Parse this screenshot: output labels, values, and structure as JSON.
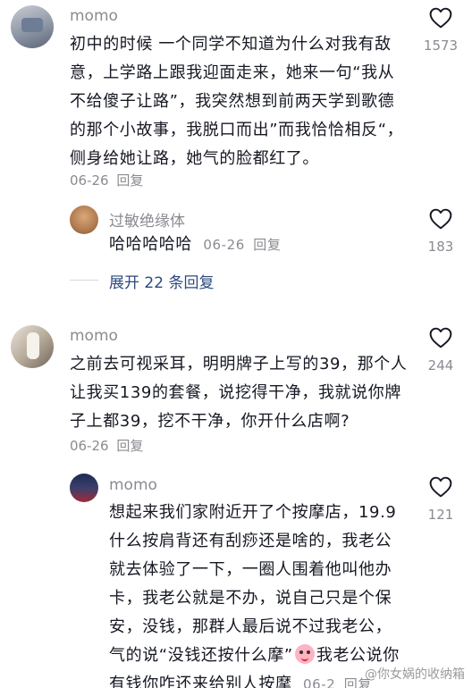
{
  "comments": [
    {
      "username": "momo",
      "text": "初中的时候 一个同学不知道为什么对我有敌意，上学路上跟我迎面走来，她来一句“我从不给傻子让路”，我突然想到前两天学到歌德的那个小故事，我脱口而出”而我恰恰相反“，侧身给她让路，她气的脸都红了。",
      "date": "06-26",
      "reply_label": "回复",
      "likes": "1573",
      "replies": [
        {
          "username": "过敏绝缘体",
          "text": "哈哈哈哈哈",
          "date": "06-26",
          "reply_label": "回复",
          "likes": "183"
        }
      ],
      "expand_label": "展开 22 条回复"
    },
    {
      "username": "momo",
      "text": "之前去可视采耳，明明牌子上写的39，那个人让我买139的套餐，说挖得干净，我就说你牌子上都39，挖不干净，你开什么店啊?",
      "date": "06-26",
      "reply_label": "回复",
      "likes": "244",
      "replies": [
        {
          "username": "momo",
          "text_before_emoji": "想起来我们家附近开了个按摩店，19.9什么按肩背还有刮痧还是啥的，我老公就去体验了一下，一圈人围着他叫他办卡，我老公就是不办，说自己只是个保安，没钱，那群人最后说不过我老公，气的说“没钱还按什么摩”",
          "text_after_emoji": "我老公说你有钱你咋还来给别人按摩",
          "date": "06-2",
          "reply_label": "回复",
          "likes": "121"
        }
      ]
    }
  ],
  "icons": {
    "like": "heart-outline-icon",
    "emoji": "crying-laugh-emoji-icon"
  },
  "watermark": "@你女娲的收纳箱"
}
